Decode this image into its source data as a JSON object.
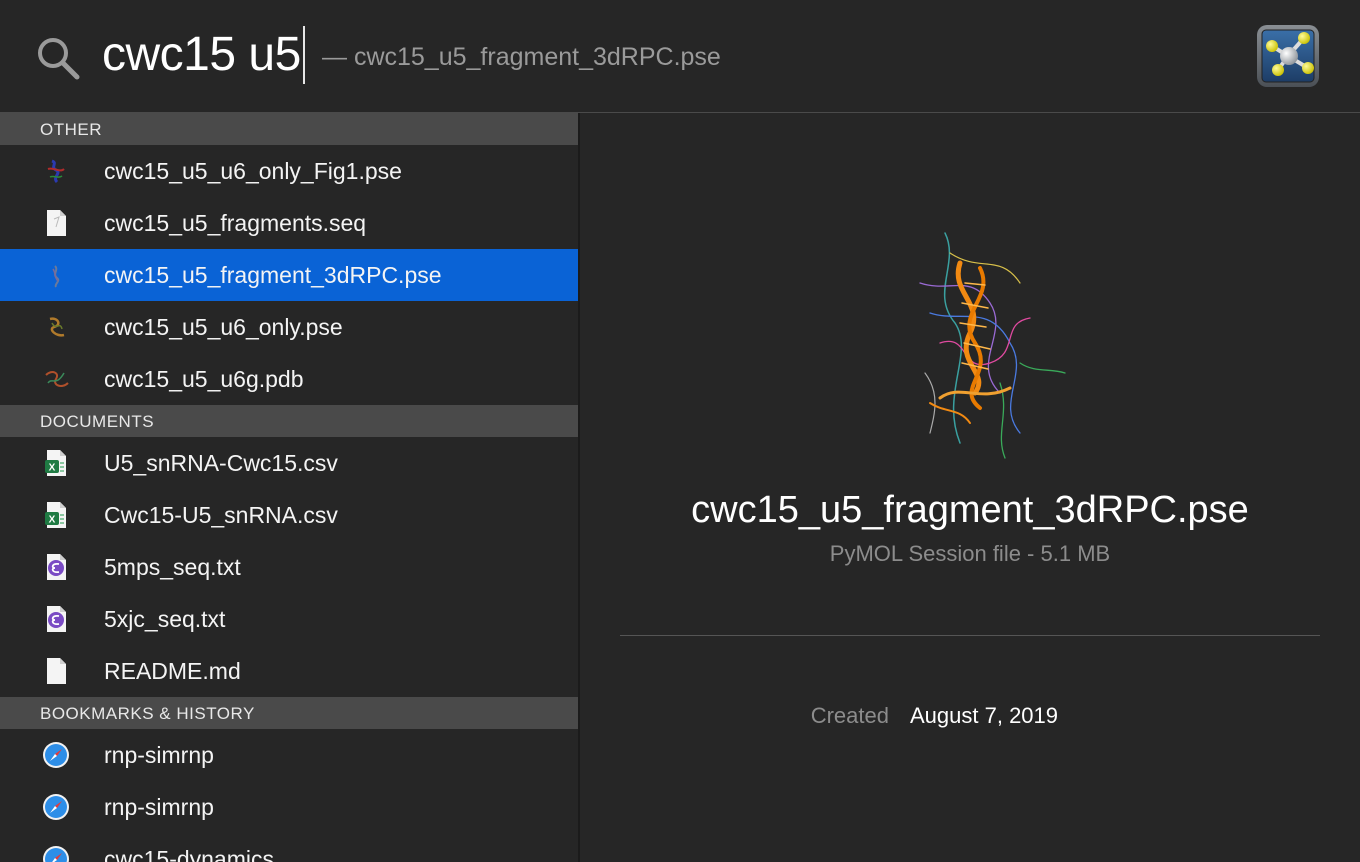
{
  "search": {
    "query": "cwc15 u5",
    "completion": "— cwc15_u5_fragment_3dRPC.pse"
  },
  "app_icon": "pymol-app-icon",
  "sections": [
    {
      "title": "OTHER",
      "items": [
        {
          "label": "cwc15_u5_u6_only_Fig1.pse",
          "icon": "molecule-thumbnail-icon"
        },
        {
          "label": "cwc15_u5_fragments.seq",
          "icon": "document-icon"
        },
        {
          "label": "cwc15_u5_fragment_3dRPC.pse",
          "icon": "molecule-thumbnail-icon",
          "selected": true
        },
        {
          "label": "cwc15_u5_u6_only.pse",
          "icon": "molecule-thumbnail-icon"
        },
        {
          "label": "cwc15_u5_u6g.pdb",
          "icon": "molecule-thumbnail-icon"
        }
      ]
    },
    {
      "title": "DOCUMENTS",
      "items": [
        {
          "label": "U5_snRNA-Cwc15.csv",
          "icon": "excel-file-icon"
        },
        {
          "label": "Cwc15-U5_snRNA.csv",
          "icon": "excel-file-icon"
        },
        {
          "label": "5mps_seq.txt",
          "icon": "emacs-file-icon"
        },
        {
          "label": "5xjc_seq.txt",
          "icon": "emacs-file-icon"
        },
        {
          "label": "README.md",
          "icon": "blank-document-icon"
        }
      ]
    },
    {
      "title": "BOOKMARKS & HISTORY",
      "items": [
        {
          "label": "rnp-simrnp",
          "icon": "safari-icon"
        },
        {
          "label": "rnp-simrnp",
          "icon": "safari-icon"
        },
        {
          "label": "cwc15-dynamics",
          "icon": "safari-icon"
        }
      ]
    }
  ],
  "preview": {
    "title": "cwc15_u5_fragment_3dRPC.pse",
    "subtitle": "PyMOL Session file - 5.1 MB",
    "created_label": "Created",
    "created_value": "August 7, 2019"
  },
  "colors": {
    "selection": "#0a63d6",
    "section_header": "#4a4a4a",
    "background": "#262626"
  }
}
